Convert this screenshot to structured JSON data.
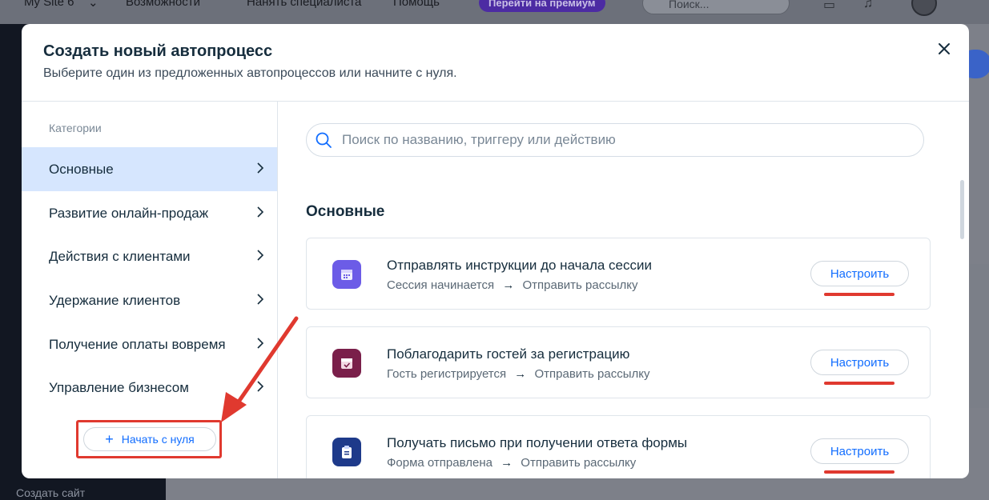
{
  "topbar": {
    "site_name": "My Site 6",
    "features": "Возможности",
    "hire": "Нанять специалиста",
    "help": "Помощь",
    "premium": "Перейти на премиум",
    "search_placeholder": "Поиск..."
  },
  "background": {
    "create_site": "Создать сайт"
  },
  "modal": {
    "title": "Создать новый автопроцесс",
    "subtitle": "Выберите один из предложенных автопроцессов или начните с нуля.",
    "categories_title": "Категории",
    "categories": [
      {
        "label": "Основные"
      },
      {
        "label": "Развитие онлайн-продаж"
      },
      {
        "label": "Действия с клиентами"
      },
      {
        "label": "Удержание клиентов"
      },
      {
        "label": "Получение оплаты вовремя"
      },
      {
        "label": "Управление бизнесом"
      }
    ],
    "start_from_scratch": "Начать с нуля",
    "search_placeholder": "Поиск по названию, триггеру или действию",
    "section_title": "Основные",
    "templates": [
      {
        "title": "Отправлять инструкции до начала сессии",
        "trigger": "Сессия начинается",
        "arrow": "→",
        "action": "Отправить рассылку",
        "button": "Настроить",
        "icon": "calendar-icon",
        "color": "#6c5ce7"
      },
      {
        "title": "Поблагодарить гостей за регистрацию",
        "trigger": "Гость регистрируется",
        "arrow": "→",
        "action": "Отправить рассылку",
        "button": "Настроить",
        "icon": "calendar-check-icon",
        "color": "#7a1f4a"
      },
      {
        "title": "Получать письмо при получении ответа формы",
        "trigger": "Форма отправлена",
        "arrow": "→",
        "action": "Отправить рассылку",
        "button": "Настроить",
        "icon": "clipboard-icon",
        "color": "#1e3a8a"
      }
    ]
  },
  "colors": {
    "accent": "#116dff",
    "annotation": "#e0392f",
    "active_bg": "#d6e6fe"
  }
}
